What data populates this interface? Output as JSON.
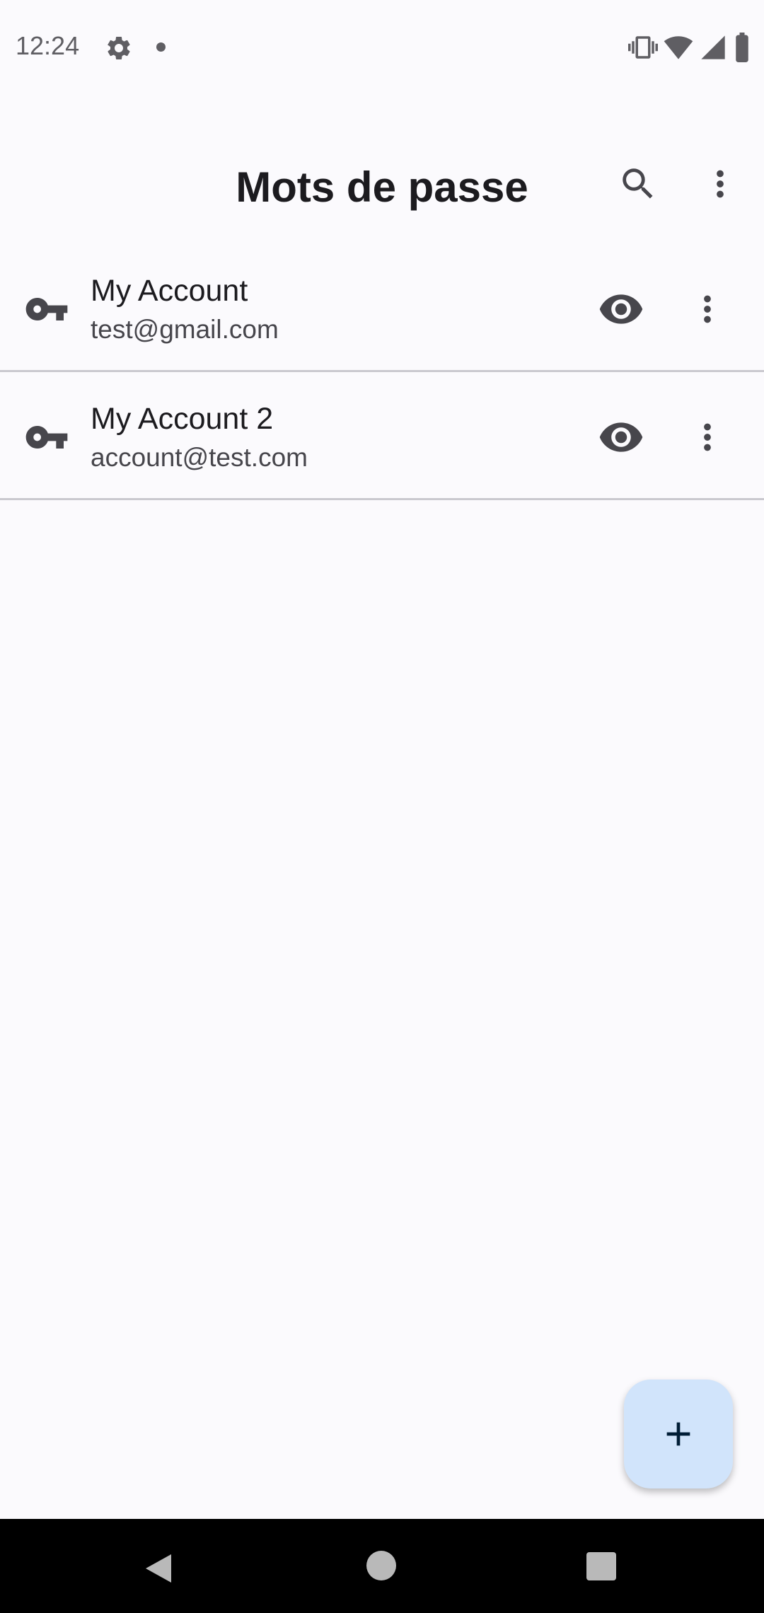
{
  "status_bar": {
    "time": "12:24",
    "icons": [
      "gear-icon",
      "notification-dot-icon",
      "vibrate-icon",
      "wifi-icon",
      "signal-icon",
      "battery-icon"
    ]
  },
  "app_bar": {
    "title": "Mots de passe",
    "actions": [
      "search-icon",
      "more-vert-icon"
    ]
  },
  "passwords": [
    {
      "name": "My Account",
      "login": "test@gmail.com",
      "icon": "key-icon"
    },
    {
      "name": "My Account 2",
      "login": "account@test.com",
      "icon": "key-icon"
    }
  ],
  "fab": {
    "icon": "plus-icon"
  },
  "nav_bar": {
    "buttons": [
      "back-icon",
      "home-icon",
      "recents-icon"
    ]
  },
  "colors": {
    "background": "#fbfafd",
    "fab_background": "#d1e4fb",
    "icon": "#47464c",
    "divider": "#cac9cf"
  }
}
